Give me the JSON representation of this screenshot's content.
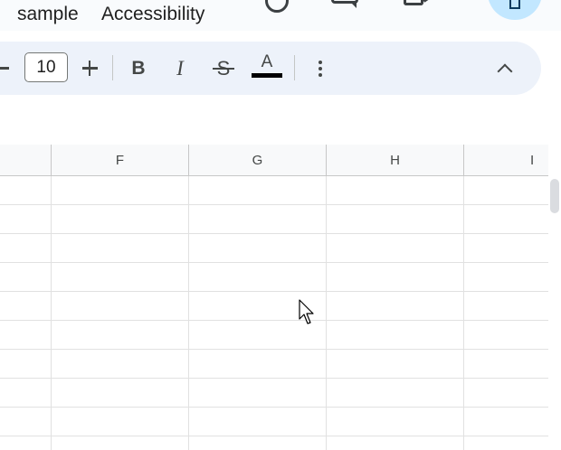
{
  "menu": {
    "items": [
      "sample",
      "Accessibility"
    ]
  },
  "toolbar": {
    "font_size": "10",
    "bold_label": "B",
    "italic_label": "I",
    "strike_label": "S",
    "text_color_label": "A",
    "text_color": "#000000",
    "icons": [
      "minus-icon",
      "plus-icon",
      "bold-icon",
      "italic-icon",
      "strikethrough-icon",
      "text-color-icon",
      "more-vert-icon",
      "chevron-up-icon"
    ]
  },
  "grid": {
    "columns": [
      "F",
      "G",
      "H",
      "I"
    ],
    "visible_rows": 10
  },
  "colors": {
    "toolbar_bg": "#edf2fa",
    "share_button_bg": "#c2e7ff",
    "header_bg": "#f8f9fa"
  }
}
